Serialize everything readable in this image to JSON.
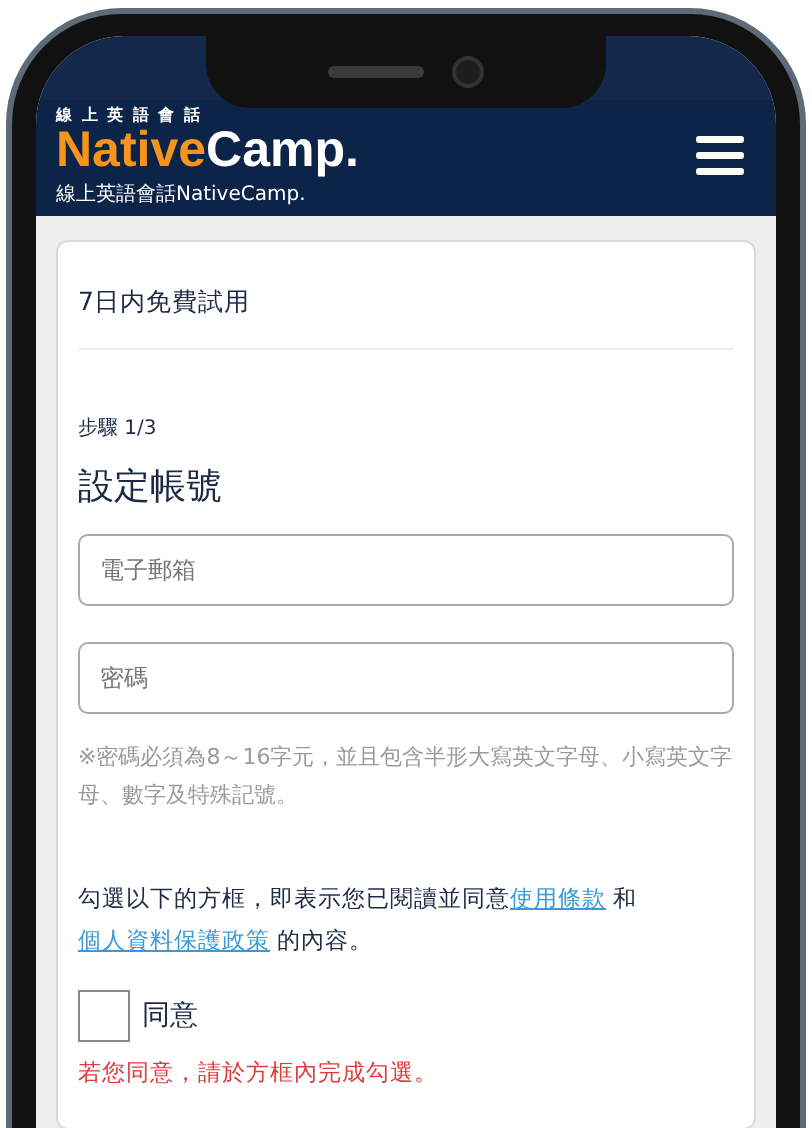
{
  "header": {
    "logo_tagline": "線 上 英 語 會 話",
    "logo": {
      "primary": "Native",
      "secondary": "Camp."
    },
    "subtitle": "線上英語會話NativeCamp."
  },
  "card": {
    "title": "7日内免費試用",
    "step": "步驟 1/3",
    "heading": "設定帳號",
    "fields": [
      {
        "placeholder": "電子郵箱"
      },
      {
        "placeholder": "密碼"
      }
    ],
    "password_hint": "※密碼必須為8～16字元，並且包含半形大寫英文字母、小寫英文字母、數字及特殊記號。",
    "consent": {
      "before": "勾選以下的方框，即表示您已閱讀並同意",
      "link1": "使用條款",
      "middle": " 和",
      "link2": "個人資料保護政策",
      "after": " 的內容。"
    },
    "agree": {
      "label": "同意",
      "checked": false
    },
    "error": "若您同意，請於方框內完成勾選。"
  }
}
